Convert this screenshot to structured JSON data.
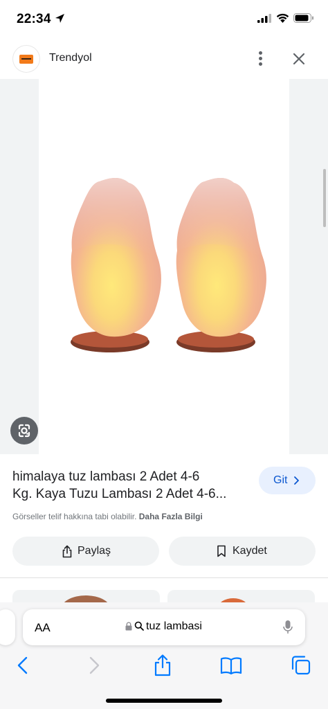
{
  "status_bar": {
    "time": "22:34"
  },
  "header": {
    "site_name": "Trendyol"
  },
  "result": {
    "title_line1": "himalaya tuz lambası 2 Adet 4-6",
    "title_line2": "Kg. Kaya Tuzu Lambası 2 Adet 4-6...",
    "visit_label": "Git",
    "copyright_text": "Görseller telif hakkına tabi olabilir.",
    "more_info_label": "Daha Fazla Bilgi",
    "share_label": "Paylaş",
    "save_label": "Kaydet"
  },
  "safari": {
    "aa_label": "AA",
    "url_text": "tuz lambasi"
  },
  "colors": {
    "accent_blue": "#0b57d0",
    "ios_blue": "#007aff",
    "brand_orange": "#f27a1a"
  },
  "icons": [
    "location-arrow-icon",
    "signal-icon",
    "wifi-icon",
    "battery-icon",
    "more-vert-icon",
    "close-icon",
    "lens-icon",
    "chevron-right-icon",
    "share-icon",
    "bookmark-icon",
    "lock-icon",
    "search-icon",
    "mic-icon",
    "back-icon",
    "forward-icon",
    "safari-share-icon",
    "book-icon",
    "tabs-icon"
  ]
}
